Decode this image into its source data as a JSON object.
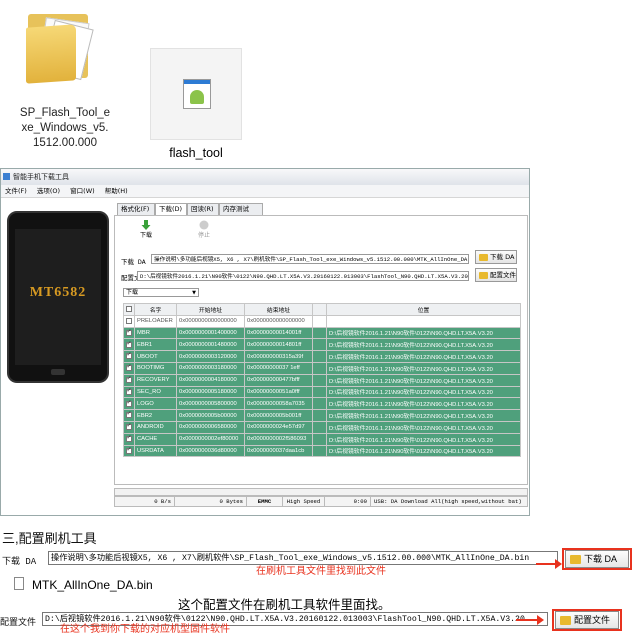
{
  "desktop": {
    "folder_label": "SP_Flash_Tool_exe_Windows_v5.1512.00.000",
    "folder_label_lines": [
      "SP_Flash_Tool_e",
      "xe_Windows_v5.",
      "1512.00.000"
    ],
    "exe_label": "flash_tool"
  },
  "window": {
    "title": "智能手机下载工具",
    "menu": [
      "文件(F)",
      "选项(O)",
      "窗口(W)",
      "帮助(H)"
    ],
    "phone_model": "MT6582",
    "tabs": [
      "格式化(F)",
      "下载(D)",
      "回读(R)",
      "内存测试(M)"
    ],
    "active_tab": "下载(D)",
    "toolbar": {
      "download": "下载",
      "stop": "停止"
    },
    "da_label": "下载 DA",
    "da_value": "操作说明\\多功能后视镜X5, X6 , X7\\刷机软件\\SP_Flash_Tool_exe_Windows_v5.1512.00.000\\MTK_AllInOne_DA.bin",
    "da_button": "下载 DA",
    "scatter_label": "配置文件",
    "scatter_value": "D:\\后视镜软件2016.1.21\\N90软件\\0122\\N90.QHD.LT.X5A.V3.20160122.013003\\FlashTool_N90.QHD.LT.X5A.V3.20",
    "scatter_button": "配置文件",
    "mode": "下载",
    "table_headers": [
      "",
      "名字",
      "开始地址",
      "结束地址",
      "",
      "位置"
    ],
    "rows": [
      {
        "checked": false,
        "name": "PRELOADER",
        "start": "0x0000000000000000",
        "end": "0x0000000000000000",
        "loc": ""
      },
      {
        "checked": true,
        "name": "MBR",
        "start": "0x0000000001400000",
        "end": "0x00000000014001ff",
        "loc": "D:\\后视镜软件2016.1.21\\N90软件\\0122\\N90.QHD.LT.X5A.V3.20"
      },
      {
        "checked": true,
        "name": "EBR1",
        "start": "0x0000000001480000",
        "end": "0x00000000014801ff",
        "loc": "D:\\后视镜软件2016.1.21\\N90软件\\0122\\N90.QHD.LT.X5A.V3.20"
      },
      {
        "checked": true,
        "name": "UBOOT",
        "start": "0x0000000003120000",
        "end": "0x000000000315a39f",
        "loc": "D:\\后视镜软件2016.1.21\\N90软件\\0122\\N90.QHD.LT.X5A.V3.20"
      },
      {
        "checked": true,
        "name": "BOOTIMG",
        "start": "0x0000000003180000",
        "end": "0x00000000037 1eff",
        "loc": "D:\\后视镜软件2016.1.21\\N90软件\\0122\\N90.QHD.LT.X5A.V3.20"
      },
      {
        "checked": true,
        "name": "RECOVERY",
        "start": "0x0000000004180000",
        "end": "0x000000000477bfff",
        "loc": "D:\\后视镜软件2016.1.21\\N90软件\\0122\\N90.QHD.LT.X5A.V3.20"
      },
      {
        "checked": true,
        "name": "SEC_RO",
        "start": "0x0000000005180000",
        "end": "0x00000000051a0fff",
        "loc": "D:\\后视镜软件2016.1.21\\N90软件\\0122\\N90.QHD.LT.X5A.V3.20"
      },
      {
        "checked": true,
        "name": "LOGO",
        "start": "0x0000000005800000",
        "end": "0x00000000058a7035",
        "loc": "D:\\后视镜软件2016.1.21\\N90软件\\0122\\N90.QHD.LT.X5A.V3.20"
      },
      {
        "checked": true,
        "name": "EBR2",
        "start": "0x0000000005b00000",
        "end": "0x0000000005b001ff",
        "loc": "D:\\后视镜软件2016.1.21\\N90软件\\0122\\N90.QHD.LT.X5A.V3.20"
      },
      {
        "checked": true,
        "name": "ANDROID",
        "start": "0x0000000006580000",
        "end": "0x0000000024e57d97",
        "loc": "D:\\后视镜软件2016.1.21\\N90软件\\0122\\N90.QHD.LT.X5A.V3.20"
      },
      {
        "checked": true,
        "name": "CACHE",
        "start": "0x0000000002ef80000",
        "end": "0x0000000002f586093",
        "loc": "D:\\后视镜软件2016.1.21\\N90软件\\0122\\N90.QHD.LT.X5A.V3.20"
      },
      {
        "checked": true,
        "name": "USRDATA",
        "start": "0x0000000036d80000",
        "end": "0x0000000037daa1cb",
        "loc": "D:\\后视镜软件2016.1.21\\N90软件\\0122\\N90.QHD.LT.X5A.V3.20"
      }
    ],
    "status": {
      "speed": "0 B/s",
      "bytes": "0 Bytes",
      "storage": "EMMC",
      "usb": "High Speed",
      "time": "0:00",
      "info": "USB: DA Download All(high speed,without bat)"
    }
  },
  "lower": {
    "heading": "三,配置刷机工具",
    "da_label": "下载 DA",
    "da_value": "操作说明\\多功能后视镜X5, X6 , X7\\刷机软件\\SP_Flash_Tool_exe_Windows_v5.1512.00.000\\MTK_AllInOne_DA.bin",
    "da_button": "下载 DA",
    "da_note": "在刷机工具文件里找到此文件",
    "file_name": "MTK_AllInOne_DA.bin",
    "scatter_note_black": "这个配置文件在刷机工具软件里面找。",
    "scatter_label": "配置文件",
    "scatter_value": "D:\\后视镜软件2016.1.21\\N90软件\\0122\\N90.QHD.LT.X5A.V3.20160122.013003\\FlashTool_N90.QHD.LT.X5A.V3.20",
    "scatter_button": "配置文件",
    "scatter_note_red": "在这个我到你下载的对应机型固件软件"
  },
  "colors": {
    "row_on": "#4fa07c",
    "accent_red": "#e8321e",
    "folder": "#e7c25a"
  }
}
